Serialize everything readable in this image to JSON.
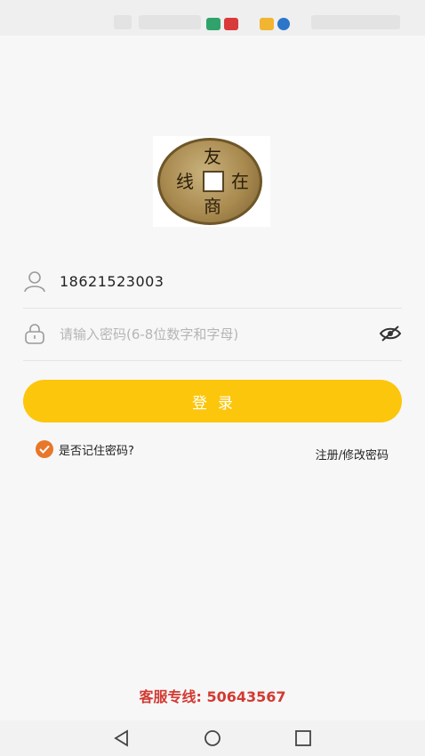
{
  "status_bar": {
    "icons": [
      "app-green-icon",
      "app-red-icon",
      "app-yellow-icon",
      "app-blue-icon",
      "wifi-icon",
      "battery-icon"
    ]
  },
  "logo": {
    "characters": {
      "top": "友",
      "left": "线",
      "right": "在",
      "bottom": "商"
    }
  },
  "login_form": {
    "username_value": "18621523003",
    "password_placeholder": "请输入密码(6-8位数字和字母)",
    "login_label": "登录",
    "remember_label": "是否记住密码?",
    "remember_checked": true,
    "register_label": "注册/修改密码"
  },
  "footer": {
    "hotline_text": "客服专线: 50643567"
  },
  "colors": {
    "accent": "#fcc60c",
    "checkbox": "#e8772b",
    "hotline": "#d23a33"
  }
}
